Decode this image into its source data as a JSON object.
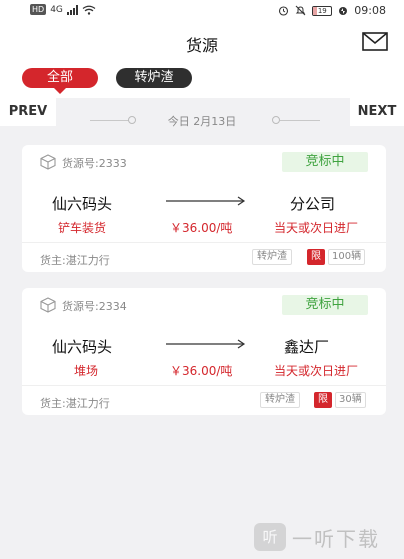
{
  "status_bar": {
    "left_badge": "HD",
    "network": "4G",
    "battery": "19",
    "time": "09:08"
  },
  "header": {
    "title": "货源",
    "mail_icon": "mail-icon"
  },
  "filters": {
    "all_label": "全部",
    "slag_label": "转炉渣"
  },
  "date_nav": {
    "prev_label": "PREV",
    "next_label": "NEXT",
    "date_text": "今日 2月13日"
  },
  "cards": [
    {
      "source_no": "货源号:2333",
      "status": "竞标中",
      "origin": "仙六码头",
      "load_type": "铲车装货",
      "price": "￥36.00/吨",
      "destination": "分公司",
      "delivery": "当天或次日进厂",
      "owner": "货主:湛江力行",
      "cargo_tag": "转炉渣",
      "limit_tag": "限",
      "count_tag": "100辆"
    },
    {
      "source_no": "货源号:2334",
      "status": "竞标中",
      "origin": "仙六码头",
      "load_type": "堆场",
      "price": "￥36.00/吨",
      "destination": "鑫达厂",
      "delivery": "当天或次日进厂",
      "owner": "货主:湛江力行",
      "cargo_tag": "转炉渣",
      "limit_tag": "限",
      "count_tag": "30辆"
    }
  ],
  "watermark": {
    "logo": "听",
    "text": "一听下载"
  },
  "colors": {
    "accent": "#d4262c",
    "bid_green": "#3fa33f",
    "background": "#f1f1f3"
  }
}
